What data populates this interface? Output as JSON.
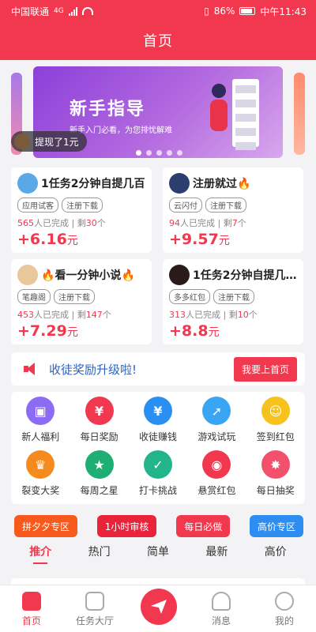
{
  "status_bar": {
    "carrier": "中国联通",
    "network": "4G",
    "battery": "86%",
    "time": "中午11:43"
  },
  "header": {
    "title": "首页"
  },
  "banner": {
    "heading": "新手指导",
    "subtitle": "新手入门必看，为您排忧解难",
    "toast_text": "提现了1元",
    "colors": {
      "gradient_start": "#8c3fd9",
      "gradient_end": "#d8a8ee"
    }
  },
  "tasks": [
    {
      "name": "1任务2分钟自提几百",
      "tags": [
        "应用试客",
        "注册下载"
      ],
      "done": "565",
      "done_suffix": "人已完成 | 剩",
      "left": "30",
      "left_suffix": "个",
      "price": "+6.16",
      "unit": "元",
      "avatar_color": "#5aa9e6"
    },
    {
      "name": "注册就过",
      "fire": "🔥",
      "tags": [
        "云闪付",
        "注册下载"
      ],
      "done": "94",
      "done_suffix": "人已完成 | 剩",
      "left": "7",
      "left_suffix": "个",
      "price": "+9.57",
      "unit": "元",
      "avatar_color": "#2c3e6e"
    },
    {
      "name": "看一分钟小说",
      "fire_pre": "🔥",
      "fire": "🔥",
      "tags": [
        "笔趣阁",
        "注册下载"
      ],
      "done": "453",
      "done_suffix": "人已完成 | 剩",
      "left": "147",
      "left_suffix": "个",
      "price": "+7.29",
      "unit": "元",
      "avatar_color": "#e8c79a"
    },
    {
      "name": "1任务2分钟自提几…",
      "tags": [
        "多多红包",
        "注册下载"
      ],
      "done": "313",
      "done_suffix": "人已完成 | 剩",
      "left": "10",
      "left_suffix": "个",
      "price": "+8.8",
      "unit": "元",
      "avatar_color": "#2a1a1a"
    }
  ],
  "notice": {
    "text": "收徒奖励升级啦!",
    "button": "我要上首页"
  },
  "grid": [
    {
      "label": "新人福利",
      "icon": "gift-icon",
      "glyph": "▣",
      "color": "#8b6cf2"
    },
    {
      "label": "每日奖励",
      "icon": "yuan-icon",
      "glyph": "¥",
      "color": "#f2384e"
    },
    {
      "label": "收徒赚钱",
      "icon": "coin-icon",
      "glyph": "¥",
      "color": "#2a8ff0"
    },
    {
      "label": "游戏试玩",
      "icon": "rocket-icon",
      "glyph": "➚",
      "color": "#3aa5f2"
    },
    {
      "label": "签到红包",
      "icon": "smile-icon",
      "glyph": "☺",
      "color": "#f7c21c"
    },
    {
      "label": "裂变大奖",
      "icon": "trophy-icon",
      "glyph": "♛",
      "color": "#f58a1f"
    },
    {
      "label": "每周之星",
      "icon": "medal-icon",
      "glyph": "★",
      "color": "#1fae74"
    },
    {
      "label": "打卡挑战",
      "icon": "calendar-check-icon",
      "glyph": "✓",
      "color": "#22b58c"
    },
    {
      "label": "悬赏红包",
      "icon": "red-envelope-icon",
      "glyph": "◉",
      "color": "#f2384e"
    },
    {
      "label": "每日抽奖",
      "icon": "wheel-icon",
      "glyph": "✸",
      "color": "#f2506c"
    }
  ],
  "pills": [
    {
      "label": "拼夕夕专区",
      "color": "#f85a1e"
    },
    {
      "label": "1小时审核",
      "color": "#e8233a"
    },
    {
      "label": "每日必做",
      "color": "#f2384e"
    },
    {
      "label": "高价专区",
      "color": "#2e8df0"
    }
  ],
  "tabs": [
    "推介",
    "热门",
    "简单",
    "最新",
    "高价"
  ],
  "nav": [
    {
      "label": "首页"
    },
    {
      "label": "任务大厅"
    },
    {
      "label": ""
    },
    {
      "label": "消息"
    },
    {
      "label": "我的"
    }
  ]
}
